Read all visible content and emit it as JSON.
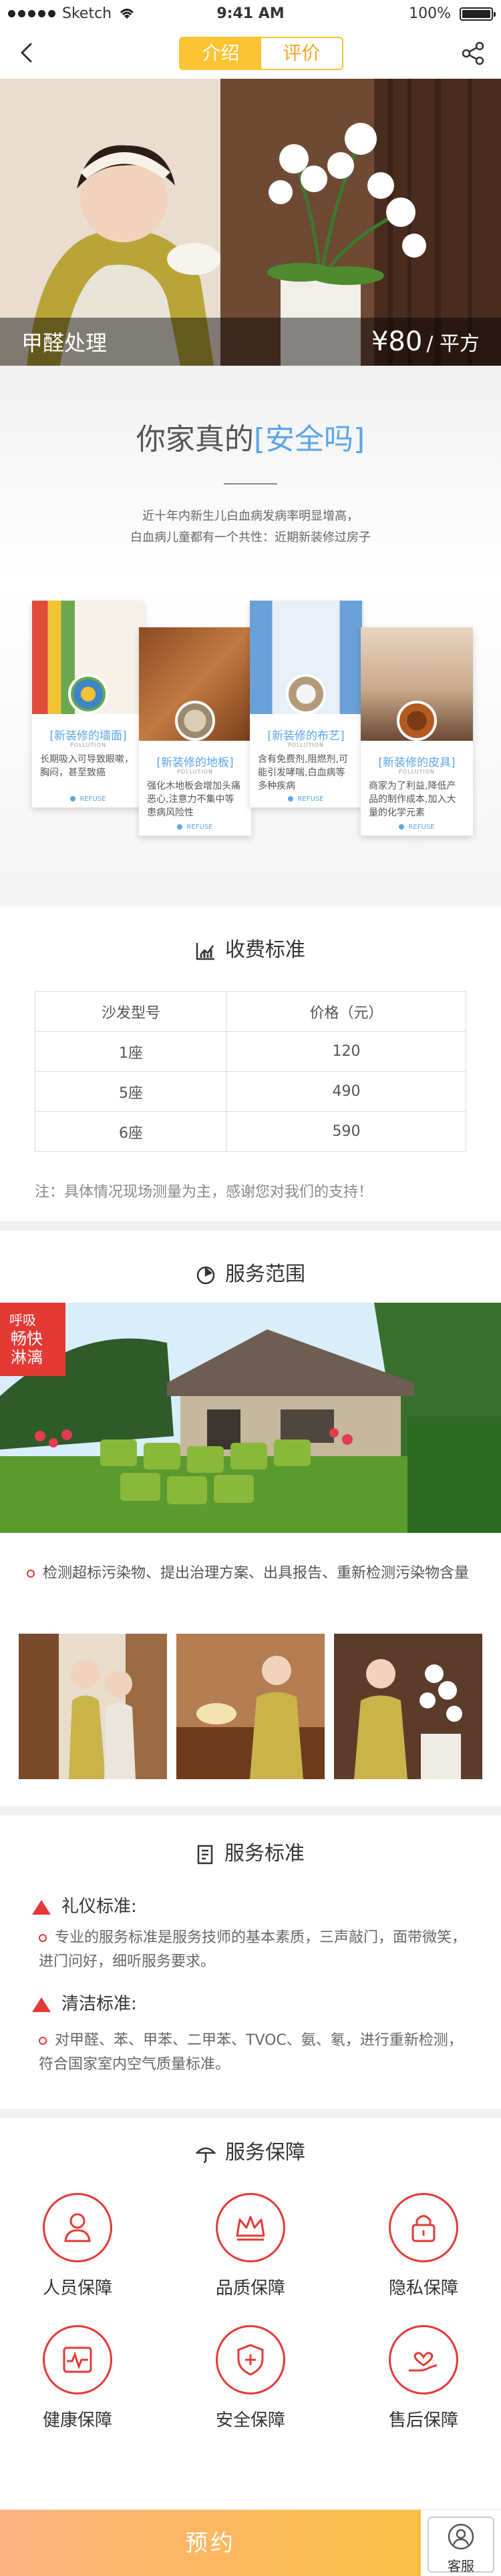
{
  "status_bar": {
    "carrier": "Sketch",
    "time": "9:41 AM",
    "battery": "100%"
  },
  "nav": {
    "tabs": [
      {
        "label": "介绍",
        "active": true
      },
      {
        "label": "评价",
        "active": false
      }
    ]
  },
  "hero": {
    "title": "甲醛处理",
    "price": "¥80",
    "unit": "/ 平方"
  },
  "safety": {
    "title_prefix": "你家真的",
    "title_highlight": "[安全吗]",
    "desc_line1": "近十年内新生儿白血病发病率明显增高，",
    "desc_line2": "白血病儿童都有一个共性：近期新装修过房子",
    "cards": [
      {
        "title": "[新装修的墙面]",
        "sub": "POLLUTION",
        "desc": "长期吸入可导致眼嗽，胸闷，甚至致癌",
        "more": "REFUSE"
      },
      {
        "title": "[新装修的地板]",
        "sub": "POLLUTION",
        "desc": "强化木地板会增加头痛恶心,注意力不集中等患病风险性",
        "more": "REFUSE"
      },
      {
        "title": "[新装修的布艺]",
        "sub": "POLLUTION",
        "desc": "含有免费剂,阻燃剂,可能引发哮喘,白血病等多种疾病",
        "more": "REFUSE"
      },
      {
        "title": "[新装修的皮具]",
        "sub": "POLLUTION",
        "desc": "商家为了利益,降低产品的制作成本,加入大量的化学元素",
        "more": "REFUSE"
      }
    ]
  },
  "pricing": {
    "title": "收费标准",
    "columns": [
      "沙发型号",
      "价格（元）"
    ],
    "rows": [
      [
        "1座",
        "120"
      ],
      [
        "5座",
        "490"
      ],
      [
        "6座",
        "590"
      ]
    ],
    "note": "注：具体情况现场测量为主，感谢您对我们的支持！"
  },
  "range": {
    "title": "服务范围",
    "badge_top": "呼吸",
    "badge_main": "畅快淋漓",
    "text": "检测超标污染物、提出治理方案、出具报告、重新检测污染物含量"
  },
  "standards": {
    "title": "服务标准",
    "items": [
      {
        "heading": "礼仪标准:",
        "text": "专业的服务标准是服务技师的基本素质，三声敲门，面带微笑，进门问好，细听服务要求。"
      },
      {
        "heading": "清洁标准:",
        "text": "对甲醛、苯、甲苯、二甲苯、TVOC、氨、氡，进行重新检测，符合国家室内空气质量标准。"
      }
    ]
  },
  "guarantee": {
    "title": "服务保障",
    "items": [
      {
        "label": "人员保障",
        "icon": "person-icon"
      },
      {
        "label": "品质保障",
        "icon": "crown-icon"
      },
      {
        "label": "隐私保障",
        "icon": "lock-icon"
      },
      {
        "label": "健康保障",
        "icon": "heartbeat-icon"
      },
      {
        "label": "安全保障",
        "icon": "shield-plus-icon"
      },
      {
        "label": "售后保障",
        "icon": "hand-heart-icon"
      }
    ]
  },
  "footer": {
    "book_label": "预约",
    "service_label": "客服"
  },
  "colors": {
    "accent": "#fcc434",
    "red": "#e53935",
    "blue": "#5aa6e6"
  }
}
